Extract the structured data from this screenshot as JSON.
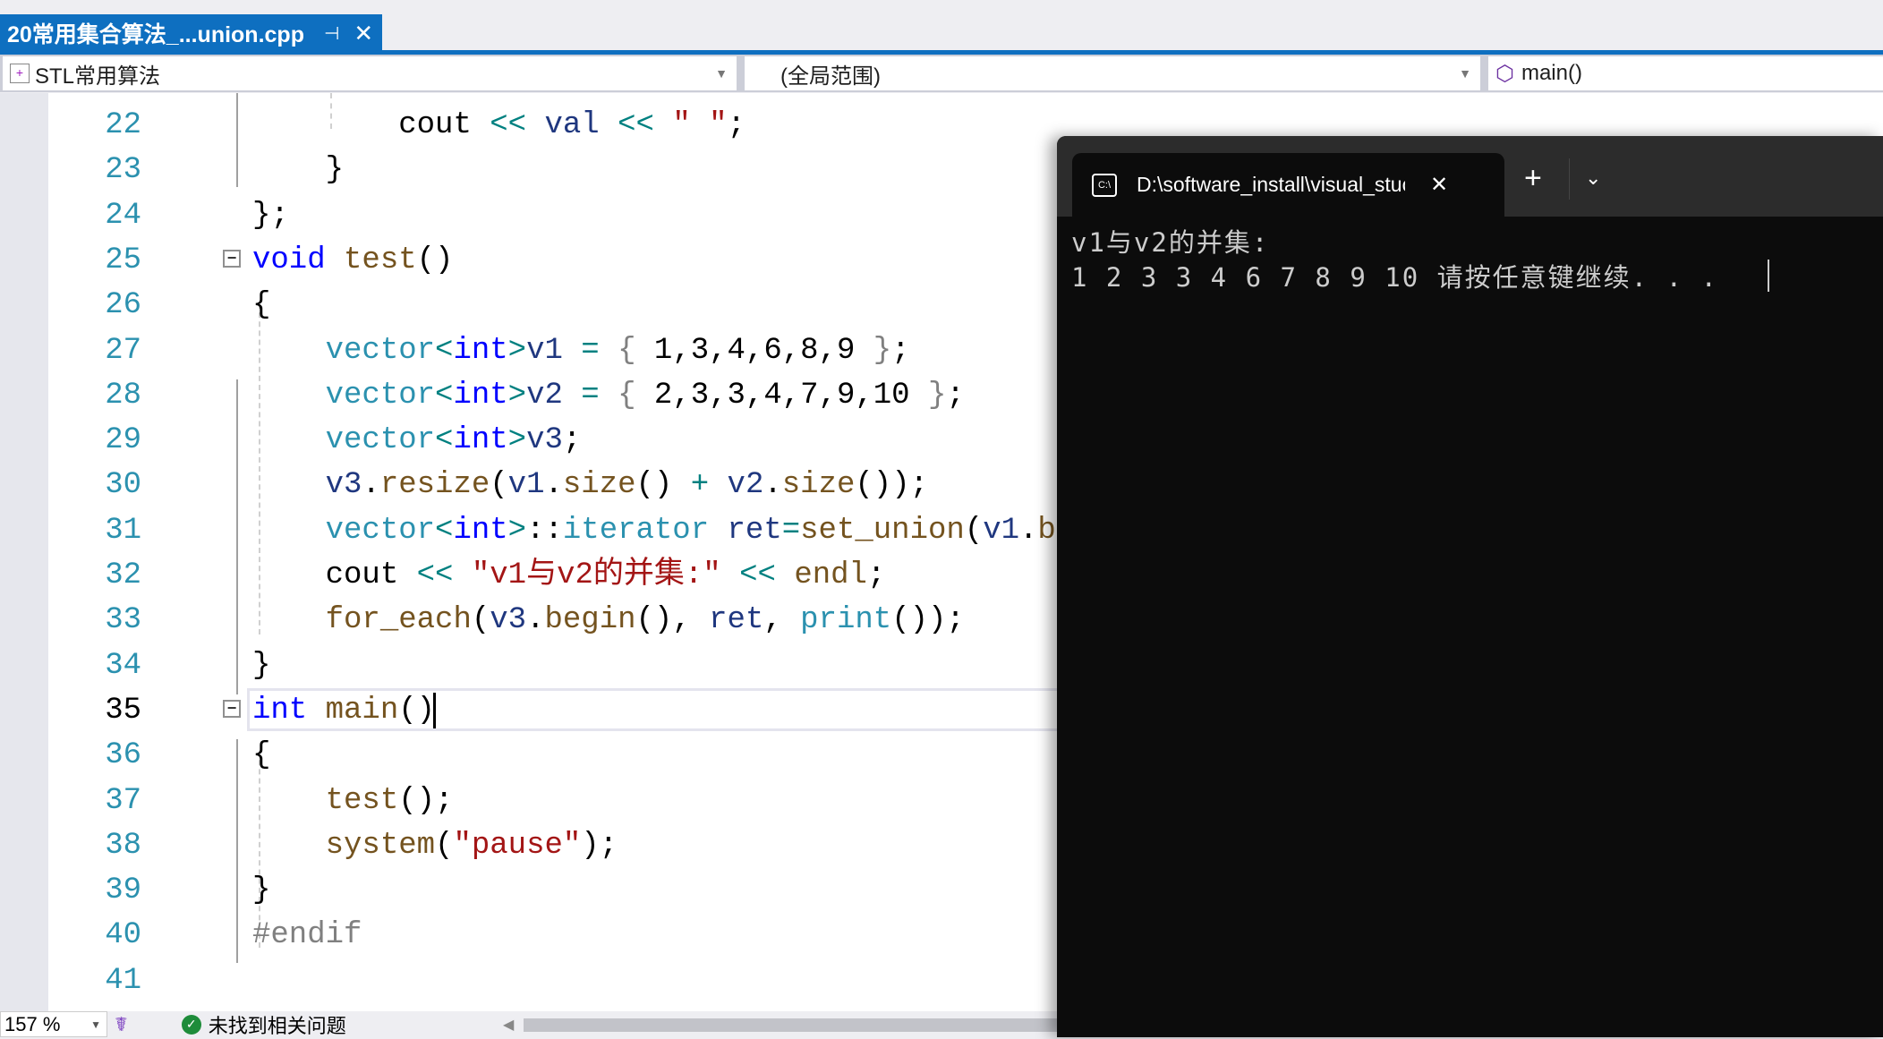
{
  "tab": {
    "title": "20常用集合算法_...union.cpp",
    "pin": "⊣",
    "close": "✕"
  },
  "nav": {
    "project": "STL常用算法",
    "scope": "(全局范围)",
    "member": "main()"
  },
  "editor": {
    "current_line": 35,
    "lines": [
      {
        "n": 22,
        "tokens": [
          [
            "        ",
            "p"
          ],
          [
            "cout",
            "p"
          ],
          [
            " ",
            "p"
          ],
          [
            "<<",
            "o"
          ],
          [
            " ",
            "p"
          ],
          [
            "val",
            "v"
          ],
          [
            " ",
            "p"
          ],
          [
            "<<",
            "o"
          ],
          [
            " ",
            "p"
          ],
          [
            "\" \"",
            "s"
          ],
          [
            ";",
            "p"
          ]
        ]
      },
      {
        "n": 23,
        "tokens": [
          [
            "    }",
            "p"
          ]
        ]
      },
      {
        "n": 24,
        "tokens": [
          [
            "};",
            "p"
          ]
        ]
      },
      {
        "n": 25,
        "tokens": [
          [
            "void",
            "k"
          ],
          [
            " ",
            "p"
          ],
          [
            "test",
            "f"
          ],
          [
            "()",
            "p"
          ]
        ]
      },
      {
        "n": 26,
        "tokens": [
          [
            "{",
            "p"
          ]
        ]
      },
      {
        "n": 27,
        "tokens": [
          [
            "    ",
            "p"
          ],
          [
            "vector",
            "t"
          ],
          [
            "<",
            "o"
          ],
          [
            "int",
            "k"
          ],
          [
            ">",
            "o"
          ],
          [
            "v1",
            "v"
          ],
          [
            " ",
            "p"
          ],
          [
            "=",
            "o"
          ],
          [
            " ",
            "p"
          ],
          [
            "{",
            "g"
          ],
          [
            " 1,3,4,6,8,9 ",
            "p"
          ],
          [
            "}",
            "g"
          ],
          [
            ";",
            "p"
          ]
        ]
      },
      {
        "n": 28,
        "tokens": [
          [
            "    ",
            "p"
          ],
          [
            "vector",
            "t"
          ],
          [
            "<",
            "o"
          ],
          [
            "int",
            "k"
          ],
          [
            ">",
            "o"
          ],
          [
            "v2",
            "v"
          ],
          [
            " ",
            "p"
          ],
          [
            "=",
            "o"
          ],
          [
            " ",
            "p"
          ],
          [
            "{",
            "g"
          ],
          [
            " 2,3,3,4,7,9,10 ",
            "p"
          ],
          [
            "}",
            "g"
          ],
          [
            ";",
            "p"
          ]
        ]
      },
      {
        "n": 29,
        "tokens": [
          [
            "    ",
            "p"
          ],
          [
            "vector",
            "t"
          ],
          [
            "<",
            "o"
          ],
          [
            "int",
            "k"
          ],
          [
            ">",
            "o"
          ],
          [
            "v3",
            "v"
          ],
          [
            ";",
            "p"
          ]
        ]
      },
      {
        "n": 30,
        "tokens": [
          [
            "    ",
            "p"
          ],
          [
            "v3",
            "v"
          ],
          [
            ".",
            "p"
          ],
          [
            "resize",
            "f"
          ],
          [
            "(",
            "p"
          ],
          [
            "v1",
            "v"
          ],
          [
            ".",
            "p"
          ],
          [
            "size",
            "f"
          ],
          [
            "() ",
            "p"
          ],
          [
            "+",
            "o"
          ],
          [
            " ",
            "p"
          ],
          [
            "v2",
            "v"
          ],
          [
            ".",
            "p"
          ],
          [
            "size",
            "f"
          ],
          [
            "());",
            "p"
          ]
        ]
      },
      {
        "n": 31,
        "tokens": [
          [
            "    ",
            "p"
          ],
          [
            "vector",
            "t"
          ],
          [
            "<",
            "o"
          ],
          [
            "int",
            "k"
          ],
          [
            ">",
            "o"
          ],
          [
            "::",
            "p"
          ],
          [
            "iterator",
            "t"
          ],
          [
            " ",
            "p"
          ],
          [
            "ret",
            "v"
          ],
          [
            "=",
            "o"
          ],
          [
            "set_union",
            "f"
          ],
          [
            "(",
            "p"
          ],
          [
            "v1",
            "v"
          ],
          [
            ".",
            "p"
          ],
          [
            "b",
            "f"
          ]
        ]
      },
      {
        "n": 32,
        "tokens": [
          [
            "    ",
            "p"
          ],
          [
            "cout",
            "p"
          ],
          [
            " ",
            "p"
          ],
          [
            "<<",
            "o"
          ],
          [
            " ",
            "p"
          ],
          [
            "\"v1与v2的并集:\"",
            "s"
          ],
          [
            " ",
            "p"
          ],
          [
            "<<",
            "o"
          ],
          [
            " ",
            "p"
          ],
          [
            "endl",
            "f"
          ],
          [
            ";",
            "p"
          ]
        ]
      },
      {
        "n": 33,
        "tokens": [
          [
            "    ",
            "p"
          ],
          [
            "for_each",
            "f"
          ],
          [
            "(",
            "p"
          ],
          [
            "v3",
            "v"
          ],
          [
            ".",
            "p"
          ],
          [
            "begin",
            "f"
          ],
          [
            "(), ",
            "p"
          ],
          [
            "ret",
            "v"
          ],
          [
            ", ",
            "p"
          ],
          [
            "print",
            "t"
          ],
          [
            "());",
            "p"
          ]
        ]
      },
      {
        "n": 34,
        "tokens": [
          [
            "}",
            "p"
          ]
        ]
      },
      {
        "n": 35,
        "tokens": [
          [
            "int",
            "k"
          ],
          [
            " ",
            "p"
          ],
          [
            "main",
            "f"
          ],
          [
            "()",
            "p"
          ]
        ]
      },
      {
        "n": 36,
        "tokens": [
          [
            "{",
            "p"
          ]
        ]
      },
      {
        "n": 37,
        "tokens": [
          [
            "    ",
            "p"
          ],
          [
            "test",
            "f"
          ],
          [
            "();",
            "p"
          ]
        ]
      },
      {
        "n": 38,
        "tokens": [
          [
            "    ",
            "p"
          ],
          [
            "system",
            "f"
          ],
          [
            "(",
            "p"
          ],
          [
            "\"pause\"",
            "s"
          ],
          [
            ");",
            "p"
          ]
        ]
      },
      {
        "n": 39,
        "tokens": [
          [
            "}",
            "p"
          ]
        ]
      },
      {
        "n": 40,
        "tokens": [
          [
            "#endif",
            "m"
          ]
        ]
      },
      {
        "n": 41,
        "tokens": []
      }
    ]
  },
  "status": {
    "zoom": "157 %",
    "issues": "未找到相关问题"
  },
  "terminal": {
    "tab_title": "D:\\software_install\\visual_stuc",
    "tab_icon_text": "C:\\",
    "close": "✕",
    "new_tab": "+",
    "menu": "⌄",
    "output": [
      "v1与v2的并集:",
      "1 2 3 3 4 6 7 8 9 10 请按任意键继续. . ."
    ]
  },
  "colors": {
    "accent": "#0e6fc0",
    "keyword": "#0000ff",
    "type": "#2b91af",
    "string": "#a31515",
    "function": "#74531f",
    "terminal_bg": "#0c0c0c"
  }
}
